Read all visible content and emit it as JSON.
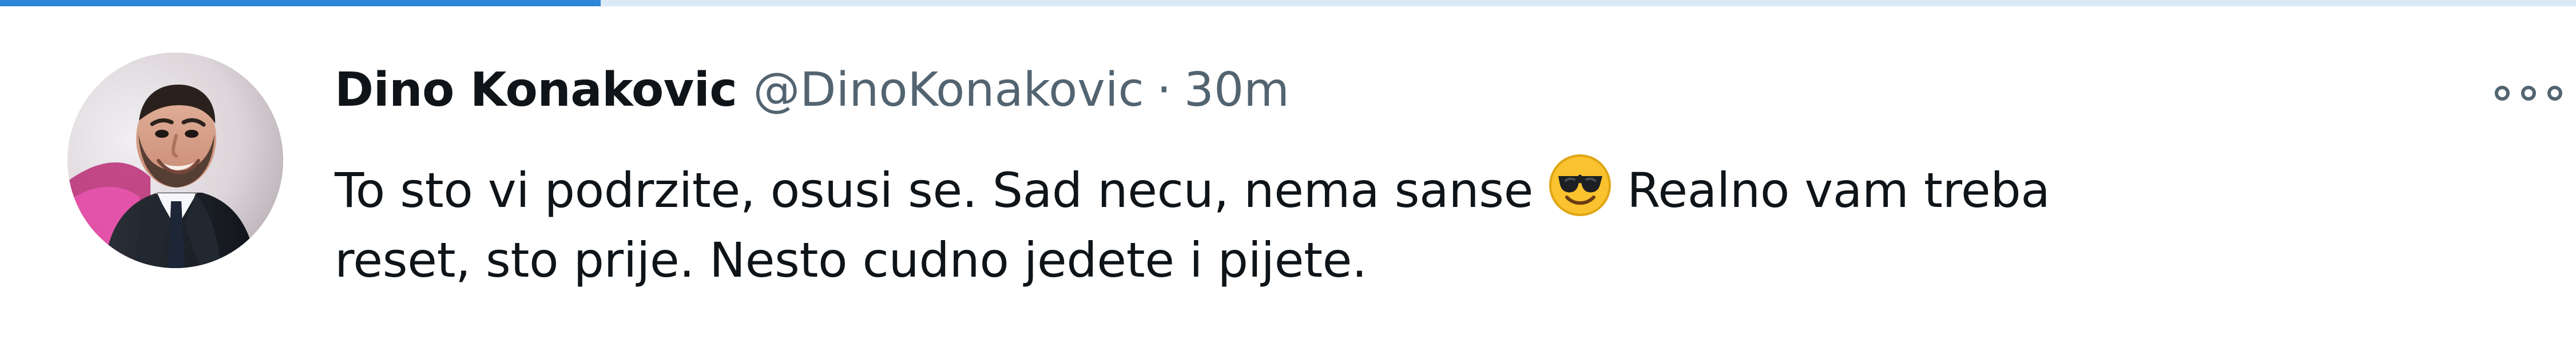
{
  "tweet": {
    "author_name": "Dino Konakovic",
    "handle": "@DinoKonakovic",
    "separator": "·",
    "time": "30m",
    "text_lines": [
      {
        "before_emoji": "To sto vi podrzite, osusi se. Sad necu, nema sanse",
        "after_emoji": "Realno vam treba"
      },
      {
        "text": "reset, sto prije. Nesto cudno jedete i pijete."
      }
    ],
    "emoji": "smiling-face-with-sunglasses",
    "more_icon": "more-options-icon"
  },
  "colors": {
    "primary_text": "#0f1419",
    "secondary_text": "#536471",
    "accent": "#2f86d6"
  }
}
